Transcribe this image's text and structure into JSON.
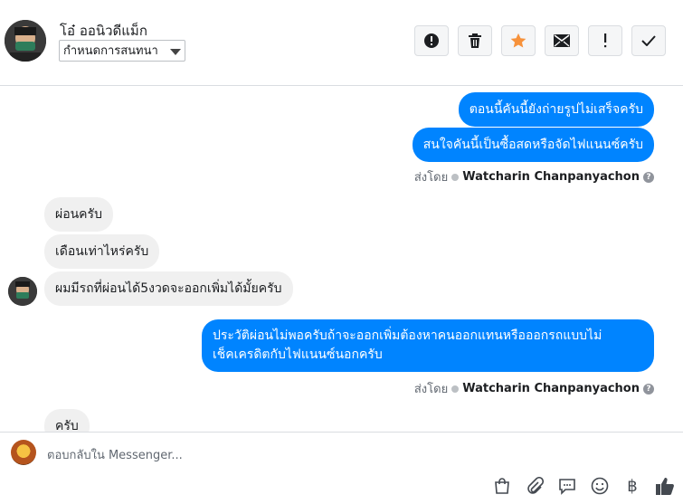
{
  "header": {
    "contact_name": "โอ๋ ออนิวดีแม็ก",
    "conversation_select": "กำหนดการสนทนา",
    "actions": [
      {
        "name": "spam-button",
        "icon": "alert-circle-icon"
      },
      {
        "name": "delete-button",
        "icon": "trash-icon"
      },
      {
        "name": "star-button",
        "icon": "star-icon",
        "color": "#f7923b"
      },
      {
        "name": "mark-unread-button",
        "icon": "envelope-icon"
      },
      {
        "name": "flag-button",
        "icon": "exclamation-icon"
      },
      {
        "name": "done-button",
        "icon": "check-icon"
      }
    ]
  },
  "messages": {
    "out_1": "ตอนนี้คันนี้ยังถ่ายรูปไม่เสร็จครับ",
    "out_2": "สนใจคันนี้เป็นซื้อสดหรือจัดไฟแนนซ์ครับ",
    "sent_by_label_1": "ส่งโดย",
    "sent_by_name_1": "Watcharin Chanpanyachon",
    "in_1": "ผ่อนครับ",
    "in_2": "เดือนเท่าไหร่ครับ",
    "in_3": "ผมมีรถที่ผ่อนได้5งวดจะออกเพิ่มได้มั้ยครับ",
    "out_3_line1": "ประวัติผ่อนไม่พอครับถ้าจะออกเพิ่มต้องหาคนออกแทนหรือออกรถแบบไม่",
    "out_3_line2": "เช็คเครดิตกับไฟแนนซ์นอกครับ",
    "sent_by_label_2": "ส่งโดย",
    "sent_by_name_2": "Watcharin Chanpanyachon",
    "in_4_partial": "ครับ",
    "help_glyph": "?"
  },
  "composer": {
    "placeholder": "ตอบกลับใน Messenger...",
    "baht_symbol": "฿",
    "icons": [
      "shopping-bag-icon",
      "paperclip-icon",
      "chat-bubble-icon",
      "emoji-icon",
      "baht-icon",
      "thumbs-up-icon"
    ]
  },
  "colors": {
    "outgoing_bubble": "#0084ff",
    "incoming_bubble": "#f0f0f0",
    "star": "#f7923b"
  }
}
